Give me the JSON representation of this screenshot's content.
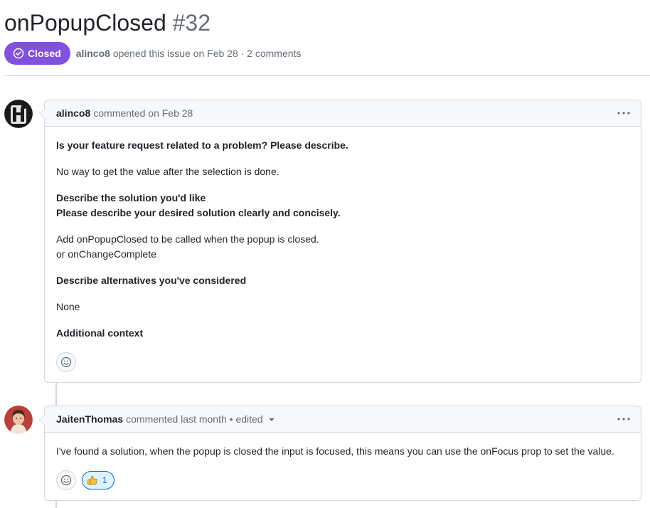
{
  "issue": {
    "title": "onPopupClosed",
    "number": "#32",
    "state": "Closed",
    "state_color": "#8250df",
    "author": "alinco8",
    "meta_rest": "opened this issue on Feb 28 · 2 comments"
  },
  "comments": [
    {
      "author": "alinco8",
      "action": "commented on Feb 28",
      "avatar_icon": "alinco8-avatar",
      "body": {
        "q1": "Is your feature request related to a problem? Please describe.",
        "a1": "No way to get the value after the selection is done.",
        "q2_line1": "Describe the solution you'd like",
        "q2_line2": "Please describe your desired solution clearly and concisely.",
        "a2_line1": "Add onPopupClosed to be called when the popup is closed.",
        "a2_line2": "or onChangeComplete",
        "q3": "Describe alternatives you've considered",
        "a3": "None",
        "q4": "Additional context"
      }
    },
    {
      "author": "JaitenThomas",
      "action": "commented last month • edited",
      "avatar_icon": "jaitenthomas-avatar",
      "body": {
        "text": "I've found a solution, when the popup is closed the input is focused, this means you can use the onFocus prop to set the value."
      },
      "reactions": [
        {
          "icon": "thumbs-up-icon",
          "count": "1"
        }
      ]
    }
  ],
  "colors": {
    "accent": "#0969da",
    "border": "#d0d7de",
    "muted": "#656d76"
  }
}
